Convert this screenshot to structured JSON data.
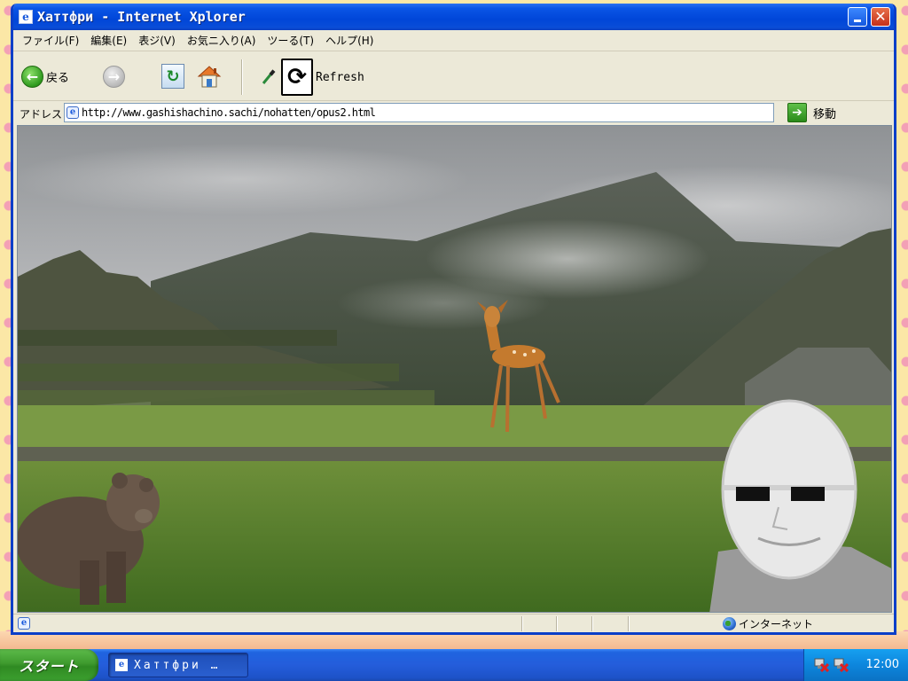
{
  "window": {
    "title": "Хаттфри - Internet Xplorer"
  },
  "menu": [
    "ファイル(F)",
    "編集(E)",
    "表ジ(V)",
    "お気ニ入り(A)",
    "ツーる(T)",
    "ヘルプ(H)"
  ],
  "toolbar": {
    "back_label": "戻る",
    "refresh_label": "Refresh"
  },
  "address": {
    "label": "アドレス",
    "url": "http://www.gashishachino.sachi/nohatten/opus2.html",
    "go_label": "移動"
  },
  "status": {
    "zone": "インターネット"
  },
  "taskbar": {
    "start_label": "スタート",
    "task_title": "Хаттфри …",
    "clock": "12:00"
  },
  "colors": {
    "title_blue": "#0a55e6",
    "taskbar_blue": "#245ddb",
    "start_green": "#3e9a2e"
  }
}
